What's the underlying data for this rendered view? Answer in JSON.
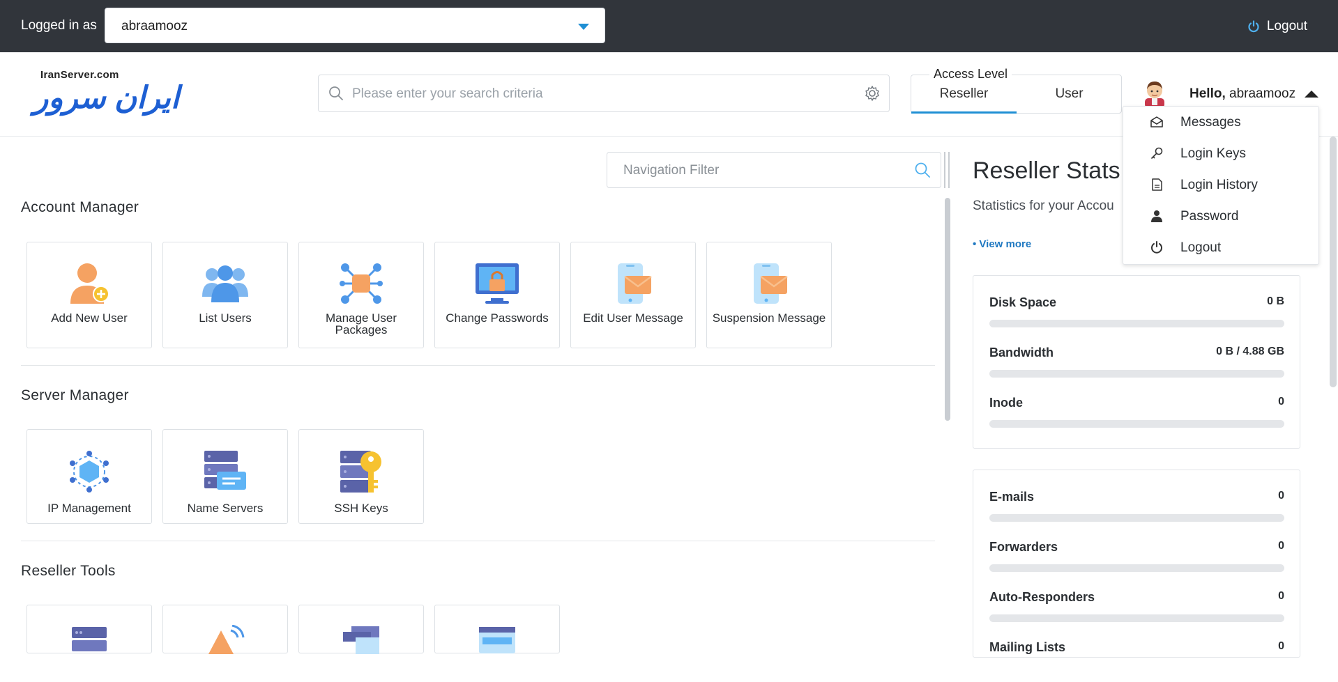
{
  "topbar": {
    "logged_in_label": "Logged in as",
    "user_select_value": "abraamooz",
    "logout_label": "Logout"
  },
  "header": {
    "logo_small": "IranServer.com",
    "logo_big": "ایران سرور",
    "search_placeholder": "Please enter your search criteria",
    "access_level": {
      "legend": "Access Level",
      "options": [
        "Reseller",
        "User"
      ],
      "selected": "Reseller"
    },
    "hello_prefix": "Hello,",
    "hello_user": "abraamooz"
  },
  "user_menu": {
    "items": [
      {
        "label": "Messages",
        "icon": "envelope-icon"
      },
      {
        "label": "Login Keys",
        "icon": "key-icon"
      },
      {
        "label": "Login History",
        "icon": "log-icon"
      },
      {
        "label": "Password",
        "icon": "user-icon"
      },
      {
        "label": "Logout",
        "icon": "power-icon"
      }
    ]
  },
  "navigation": {
    "filter_placeholder": "Navigation Filter",
    "sections": [
      {
        "title": "Account Manager",
        "tiles": [
          {
            "label": "Add New User",
            "icon": "add-user-icon"
          },
          {
            "label": "List Users",
            "icon": "users-icon"
          },
          {
            "label": "Manage User Packages",
            "icon": "packages-icon"
          },
          {
            "label": "Change Passwords",
            "icon": "lock-monitor-icon"
          },
          {
            "label": "Edit User Message",
            "icon": "phone-mail-icon"
          },
          {
            "label": "Suspension Message",
            "icon": "phone-mail-icon"
          }
        ]
      },
      {
        "title": "Server Manager",
        "tiles": [
          {
            "label": "IP Management",
            "icon": "network-icon"
          },
          {
            "label": "Name Servers",
            "icon": "server-icon"
          },
          {
            "label": "SSH Keys",
            "icon": "server-key-icon"
          }
        ]
      },
      {
        "title": "Reseller Tools",
        "tiles": [
          {
            "label": "",
            "icon": "server-stack-icon"
          },
          {
            "label": "",
            "icon": "broadcast-icon"
          },
          {
            "label": "",
            "icon": "layers-icon"
          },
          {
            "label": "",
            "icon": "window-icon"
          }
        ]
      }
    ]
  },
  "stats": {
    "title": "Reseller Stats",
    "subtitle": "Statistics for your Accou",
    "view_more": "• View more",
    "cards": [
      [
        {
          "label": "Disk Space",
          "value": "0 B",
          "fill": 0
        },
        {
          "label": "Bandwidth",
          "value": "0 B / 4.88 GB",
          "fill": 0
        },
        {
          "label": "Inode",
          "value": "0",
          "fill": 0
        }
      ],
      [
        {
          "label": "E-mails",
          "value": "0",
          "fill": 0
        },
        {
          "label": "Forwarders",
          "value": "0",
          "fill": 0
        },
        {
          "label": "Auto-Responders",
          "value": "0",
          "fill": 0
        },
        {
          "label": "Mailing Lists",
          "value": "0",
          "fill": 0
        }
      ]
    ]
  },
  "colors": {
    "topbar": "#31353b",
    "accent": "#1f8fd4",
    "link": "#1f78c1"
  }
}
